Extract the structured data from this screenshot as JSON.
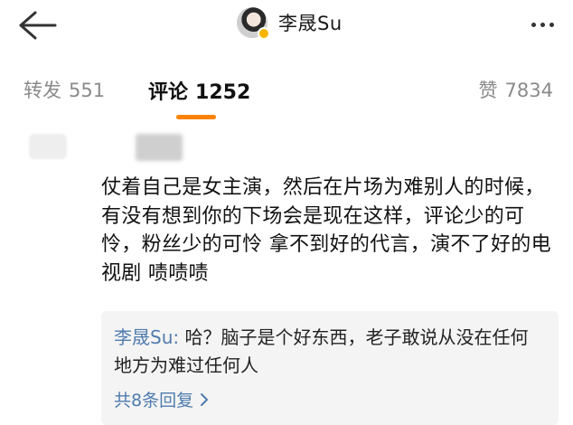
{
  "header": {
    "title": "李晟Su",
    "back_icon": "arrow-left-icon",
    "more_icon": "more-horizontal-icon",
    "verified_color": "#f7b500"
  },
  "tabs": [
    {
      "label": "转发",
      "count": "551",
      "active": false
    },
    {
      "label": "评论",
      "count": "1252",
      "active": true
    },
    {
      "label": "赞",
      "count": "7834",
      "active": false
    }
  ],
  "accent_color": "#ff8200",
  "comment": {
    "text": "仗着自己是女主演，然后在片场为难别人的时候，有没有想到你的下场会是现在这样，评论少的可怜，粉丝少的可怜 拿不到好的代言，演不了好的电视剧 啧啧啧",
    "reply": {
      "author": "李晟Su:",
      "text": " 哈？脑子是个好东西，老子敢说从没在任何地方为难过任何人",
      "count_label": "共8条回复",
      "link_color": "#4f7cae"
    }
  }
}
